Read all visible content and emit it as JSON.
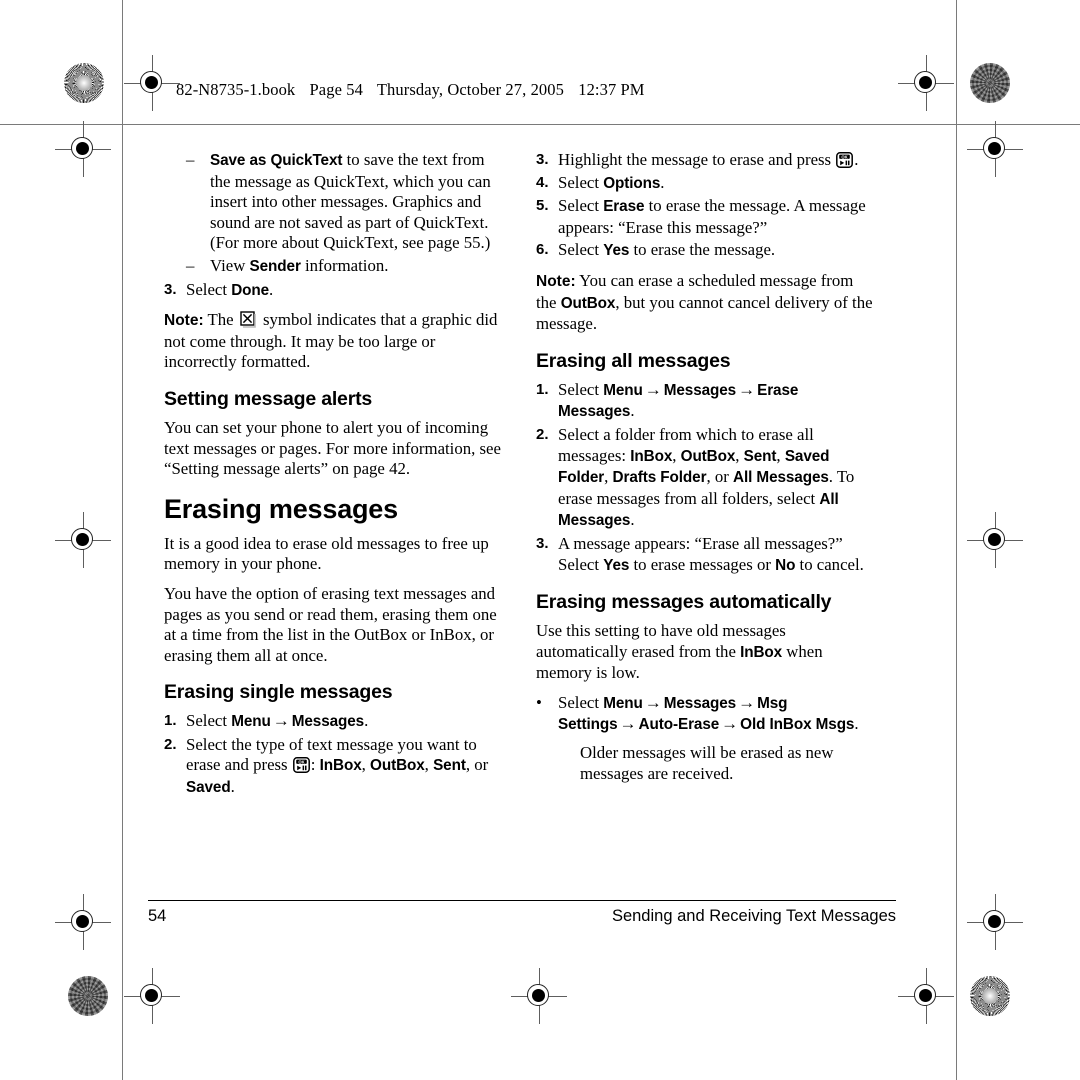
{
  "slug": {
    "filename": "82-N8735-1.book",
    "page": "Page 54",
    "weekday": "Thursday, October 27, 2005",
    "time": "12:37 PM"
  },
  "icons": {
    "ok_key": "ok-play-pause-key-icon",
    "missing_graphic": "boxed-x-icon",
    "registration": "registration-target-icon",
    "starburst": "starburst-rosette-icon",
    "textured_dot": "textured-dot-rosette-icon"
  },
  "left_column": {
    "sub_items": [
      {
        "marker": "–",
        "lead": "Save as QuickText",
        "text": " to save the text from the message as QuickText, which you can insert into other messages. Graphics and sound are not saved as part of QuickText.(For more about QuickText, see page 55.)"
      },
      {
        "marker": "–",
        "pre": "View ",
        "lead": "Sender",
        "text": " information."
      }
    ],
    "step_done": {
      "marker": "3.",
      "pre": "Select ",
      "lead": "Done",
      "text": "."
    },
    "note_graphic": {
      "label": "Note:",
      "before_icon": " The ",
      "after_icon": " symbol indicates that a graphic did not come through. It may be too large or incorrectly formatted."
    },
    "heading_alerts": "Setting message alerts",
    "para_alerts": "You can set your phone to alert you of incoming text messages or pages. For more information, see “Setting message alerts” on page 42.",
    "heading_erasing": "Erasing messages",
    "para_erasing_1": "It is a good idea to erase old messages to free up memory in your phone.",
    "para_erasing_2": "You have the option of erasing text messages and pages as you send or read them, erasing them one at a time from the list in the OutBox or InBox, or erasing them all at once.",
    "heading_single": "Erasing single messages",
    "steps_single": [
      {
        "marker": "1.",
        "pre": "Select ",
        "menu": [
          "Menu",
          "Messages"
        ],
        "post": "."
      },
      {
        "marker": "2.",
        "pre": "Select the type of text message you want to erase and press ",
        "after_icon": ": ",
        "options": [
          "InBox",
          "OutBox",
          "Sent"
        ],
        "tail_pre": ", or ",
        "tail_bold": "Saved",
        "tail_post": "."
      }
    ]
  },
  "right_column": {
    "steps_single_cont": [
      {
        "marker": "3.",
        "pre": "Highlight the message to erase and press ",
        "post": "."
      },
      {
        "marker": "4.",
        "pre": "Select ",
        "lead": "Options",
        "post": "."
      },
      {
        "marker": "5.",
        "pre": "Select ",
        "lead": "Erase",
        "post": " to erase the message. A message appears: “Erase this message?”"
      },
      {
        "marker": "6.",
        "pre": "Select ",
        "lead": "Yes",
        "post": " to erase the message."
      }
    ],
    "note_scheduled": {
      "label": "Note:",
      "pre": " You can erase a scheduled message from the ",
      "lead": "OutBox",
      "post": ", but you cannot cancel delivery of the message."
    },
    "heading_all": "Erasing all messages",
    "steps_all": [
      {
        "marker": "1.",
        "pre": "Select ",
        "menu": [
          "Menu",
          "Messages",
          "Erase Messages"
        ],
        "post": "."
      },
      {
        "marker": "2.",
        "pre": "Select a folder from which to erase all messages: ",
        "folders": [
          "InBox",
          "OutBox",
          "Sent",
          "Saved Folder",
          "Drafts Folder"
        ],
        "mid": ", or ",
        "last_folder": "All Messages",
        "tail": ". To erase messages from all folders, select ",
        "tail_bold": "All Messages",
        "tail_end": "."
      },
      {
        "marker": "3.",
        "pre": "A message appears: “Erase all messages?” Select ",
        "yes": "Yes",
        "mid": " to erase messages or ",
        "no": "No",
        "post": " to cancel."
      }
    ],
    "heading_auto": "Erasing messages automatically",
    "para_auto_pre": "Use this setting to have old messages automatically erased from the ",
    "para_auto_bold": "InBox",
    "para_auto_post": " when memory is low.",
    "bullet_auto": {
      "marker": "•",
      "pre": "Select ",
      "menu": [
        "Menu",
        "Messages",
        "Msg Settings",
        "Auto-Erase",
        "Old InBox Msgs"
      ],
      "post": "."
    },
    "para_auto_after": "Older messages will be erased as new messages are received."
  },
  "footer": {
    "page_number": "54",
    "section_title": "Sending and Receiving Text Messages"
  }
}
